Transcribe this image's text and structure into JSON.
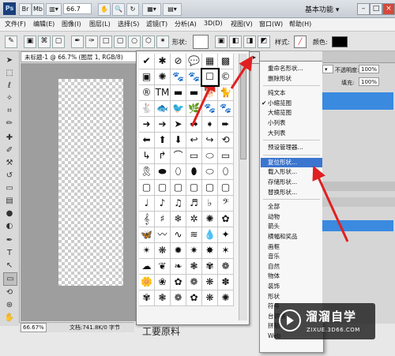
{
  "app": {
    "logo": "Ps",
    "zoom": "66.7",
    "workspace": "基本功能 ▾",
    "bar_labels": [
      "Br",
      "Mb",
      "▥▾",
      "✋",
      "🔍",
      "↻",
      "▦▾",
      "▤▾"
    ]
  },
  "menubar": [
    "文件(F)",
    "编辑(E)",
    "图像(I)",
    "图层(L)",
    "选择(S)",
    "滤镜(T)",
    "分析(A)",
    "3D(D)",
    "视图(V)",
    "窗口(W)",
    "帮助(H)"
  ],
  "options": {
    "shape_label": "形状:",
    "style_label": "样式:",
    "color_label": "颜色:"
  },
  "document": {
    "tab_title": "未标题-1 @ 66.7% (图层 1, RGB/8)",
    "zoom_status": "66.67%",
    "doc_status": "文档:741.8K/0 字节"
  },
  "shape_rows": [
    [
      "✔",
      "✱",
      "⊘",
      "💬",
      "▦",
      "▩"
    ],
    [
      "▣",
      "✺",
      "🐾",
      "🐾",
      "☐",
      "©"
    ],
    [
      "®",
      "TM",
      "▬",
      "▬",
      "🐕",
      "🐈"
    ],
    [
      "🐇",
      "🐟",
      "🐦",
      "🌿",
      "🐾",
      "🐾"
    ],
    [
      "➜",
      "➔",
      "➤",
      "➡",
      "➧",
      "➨"
    ],
    [
      "⬅",
      "⬆",
      "⬇",
      "↩",
      "↪",
      "⟲"
    ],
    [
      "↳",
      "↱",
      "⌒",
      "▭",
      "⬭",
      "▭"
    ],
    [
      "🎗",
      "⬬",
      "⬯",
      "⬮",
      "⬭",
      "⬯"
    ],
    [
      "▢",
      "▢",
      "▢",
      "▢",
      "▢",
      "▢"
    ],
    [
      "♩",
      "♪",
      "♫",
      "♬",
      "♭",
      "𝄢"
    ],
    [
      "𝄞",
      "♯",
      "❄",
      "✲",
      "✺",
      "✿"
    ],
    [
      "🦋",
      "〰",
      "∿",
      "≋",
      "💧",
      "✦"
    ],
    [
      "✴",
      "❋",
      "✹",
      "✷",
      "✸",
      "✶"
    ],
    [
      "☁",
      "❦",
      "❧",
      "❃",
      "✾",
      "❁"
    ],
    [
      "🌼",
      "❀",
      "✿",
      "❁",
      "❋",
      "✽"
    ],
    [
      "✾",
      "❃",
      "❁",
      "✿",
      "❋",
      "✺"
    ]
  ],
  "menu_items": [
    {
      "label": "重命名形状...",
      "check": false
    },
    {
      "label": "删除形状",
      "check": false
    },
    {
      "label": "纯文本",
      "check": false
    },
    {
      "label": "小缩览图",
      "check": true
    },
    {
      "label": "大缩览图",
      "check": false
    },
    {
      "label": "小列表",
      "check": false
    },
    {
      "label": "大列表",
      "check": false
    },
    {
      "label": "预设管理器...",
      "check": false
    },
    {
      "label": "复位形状...",
      "check": false,
      "highlight": true
    },
    {
      "label": "载入形状...",
      "check": false
    },
    {
      "label": "存储形状...",
      "check": false
    },
    {
      "label": "替换形状...",
      "check": false
    },
    {
      "label": "全部",
      "check": false
    },
    {
      "label": "动物",
      "check": false
    },
    {
      "label": "箭头",
      "check": false
    },
    {
      "label": "横幅和奖品",
      "check": false
    },
    {
      "label": "画框",
      "check": false
    },
    {
      "label": "音乐",
      "check": false
    },
    {
      "label": "自然",
      "check": false
    },
    {
      "label": "物体",
      "check": false
    },
    {
      "label": "装饰",
      "check": false
    },
    {
      "label": "形状",
      "check": false
    },
    {
      "label": "符号",
      "check": false
    },
    {
      "label": "台词框",
      "check": false
    },
    {
      "label": "拼贴",
      "check": false
    },
    {
      "label": "Web",
      "check": false
    }
  ],
  "right_panel": {
    "opacity_label": "不透明度:",
    "opacity": "100%",
    "fill_label": "填充:",
    "fill": "100%",
    "dropdown": "▾"
  },
  "watermark": {
    "title": "溜溜自学",
    "url": "ZIXUE.3D66.COM"
  },
  "caption": "工要原料",
  "colors": {
    "highlight": "#3b75cf",
    "arrow": "#e02020"
  }
}
